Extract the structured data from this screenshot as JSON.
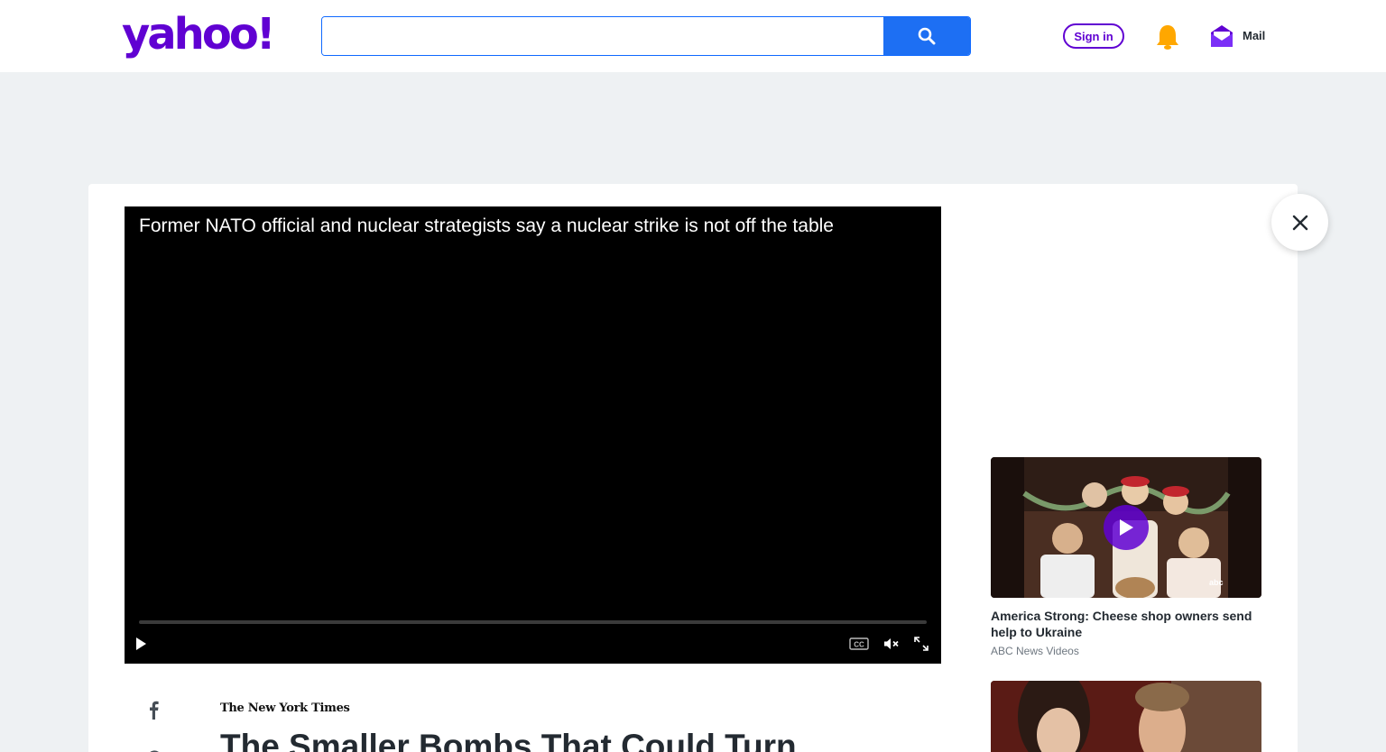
{
  "header": {
    "logo_text": "yahoo!",
    "search": {
      "value": "",
      "placeholder": ""
    },
    "signin_label": "Sign in",
    "mail_label": "Mail",
    "icons": {
      "search": "search-icon",
      "bell": "bell-icon",
      "mail": "mail-icon"
    }
  },
  "video": {
    "title": "Former NATO official and nuclear strategists say a nuclear strike is not off the table",
    "progress": 0,
    "controls": [
      "play-icon",
      "closed-captions-icon",
      "mute-icon",
      "fullscreen-icon"
    ]
  },
  "sidebar": {
    "items": [
      {
        "title": "America Strong: Cheese shop owners send help to Ukraine",
        "source": "ABC News Videos",
        "badge": "abc"
      },
      {
        "title": "",
        "source": ""
      }
    ]
  },
  "article": {
    "publisher": "The New York Times",
    "headline": "The Smaller Bombs That Could Turn"
  },
  "colors": {
    "brand": "#6001d2",
    "search_button": "#1d6ff3",
    "bell": "#ffa700",
    "page_bg": "#eef1f3"
  }
}
